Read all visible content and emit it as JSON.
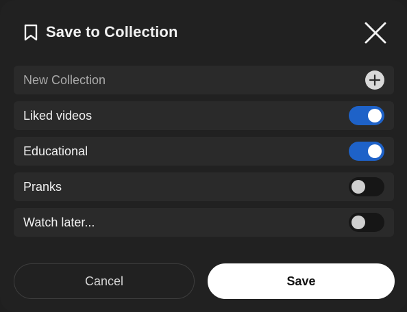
{
  "dialog": {
    "title": "Save to Collection",
    "icons": {
      "title_icon": "bookmark-icon",
      "close_icon": "close-icon",
      "add_icon": "plus-icon"
    },
    "new_collection": {
      "placeholder": "New Collection"
    },
    "collections": [
      {
        "label": "Liked videos",
        "selected": true
      },
      {
        "label": "Educational",
        "selected": true
      },
      {
        "label": "Pranks",
        "selected": false
      },
      {
        "label": "Watch later...",
        "selected": false
      }
    ],
    "buttons": {
      "cancel_label": "Cancel",
      "save_label": "Save"
    },
    "colors": {
      "toggle_on": "#1e62c8",
      "background": "#212121"
    }
  }
}
